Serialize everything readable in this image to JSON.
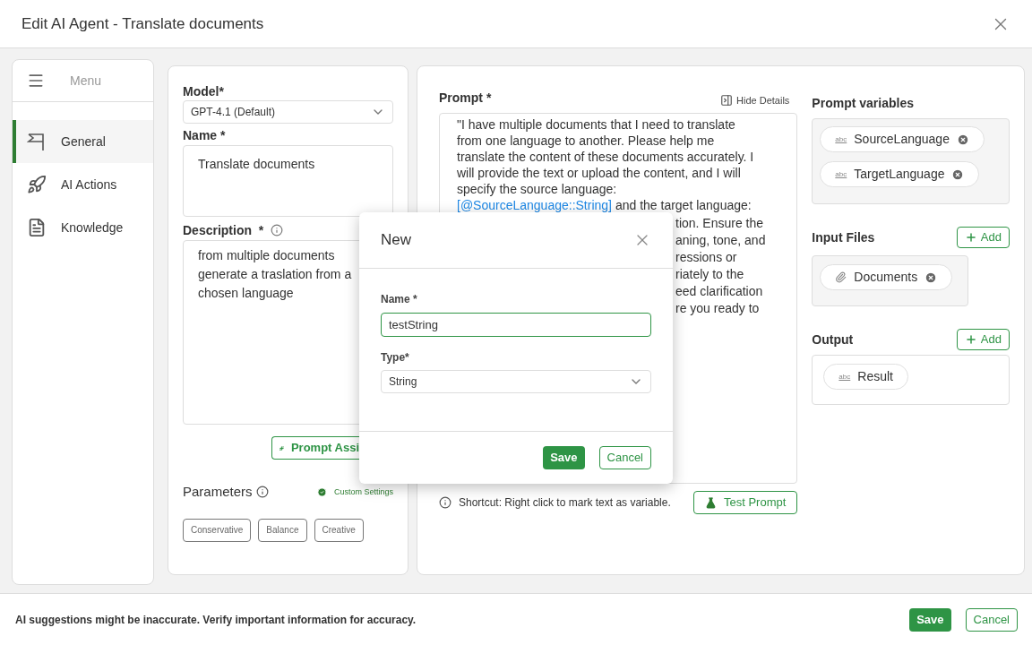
{
  "header": {
    "title": "Edit AI Agent - Translate documents"
  },
  "sidebar": {
    "menu_label": "Menu",
    "items": [
      {
        "label": "General",
        "selected": true
      },
      {
        "label": "AI Actions",
        "selected": false
      },
      {
        "label": "Knowledge",
        "selected": false
      }
    ]
  },
  "general": {
    "model": {
      "label": "Model*",
      "value": "GPT-4.1 (Default)"
    },
    "name": {
      "label": "Name *",
      "value": "Translate documents"
    },
    "description": {
      "label": "Description  *",
      "lines": [
        "from multiple documents",
        "generate a traslation from a",
        "chosen language"
      ]
    },
    "prompt_assistant": "Prompt Assi",
    "parameters": {
      "label": "Parameters",
      "status": "Custom Settings",
      "presets": [
        "Conservative",
        "Balance",
        "Creative"
      ]
    }
  },
  "prompt": {
    "label": "Prompt *",
    "hide_details": "Hide Details",
    "lines": [
      {
        "text": "\"I have multiple documents that I need to translate"
      },
      {
        "text": "from one language to another. Please help me"
      },
      {
        "text": "translate the content of these documents accurately. I"
      },
      {
        "text": "will provide the text or upload the content, and I will"
      },
      {
        "text": "specify the source language:"
      },
      {
        "link": "[@SourceLanguage::String]",
        "text": " and the target language:"
      }
    ],
    "fragments": [
      "tion. Ensure the",
      "aning, tone, and",
      "ressions or",
      "riately to the",
      "eed clarification",
      "re you ready to"
    ],
    "shortcut": "Shortcut: Right click to mark text as variable.",
    "test_button": "Test Prompt"
  },
  "variables": {
    "label": "Prompt variables",
    "items": [
      {
        "kind": "variable",
        "type": "abc",
        "name": "SourceLanguage",
        "removable": true
      },
      {
        "kind": "variable",
        "type": "abc",
        "name": "TargetLanguage",
        "removable": true
      }
    ]
  },
  "input_files": {
    "label": "Input Files",
    "add": "Add",
    "items": [
      {
        "kind": "file",
        "name": "Documents",
        "removable": true
      }
    ]
  },
  "output": {
    "label": "Output",
    "add": "Add",
    "items": [
      {
        "kind": "variable",
        "type": "abc",
        "name": "Result",
        "removable": false
      }
    ]
  },
  "dialog": {
    "title": "New",
    "name_label": "Name *",
    "name_value": "testString",
    "type_label": "Type*",
    "type_value": "String",
    "save": "Save",
    "cancel": "Cancel"
  },
  "footer": {
    "notice": "AI suggestions might be inaccurate. Verify important information for accuracy.",
    "save": "Save",
    "cancel": "Cancel"
  }
}
